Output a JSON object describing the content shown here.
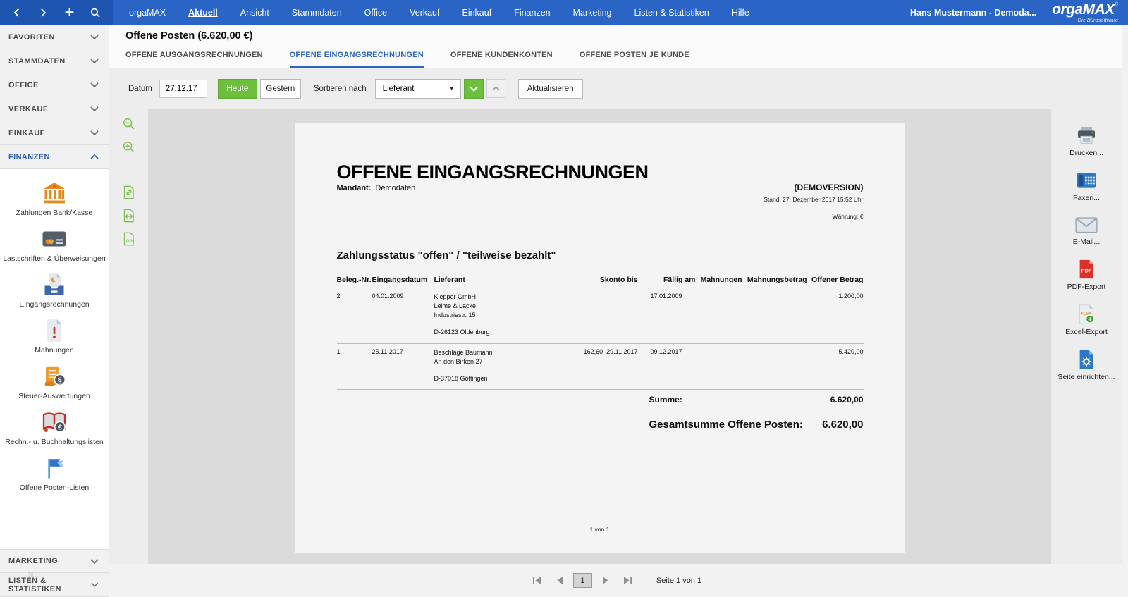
{
  "colors": {
    "topbar_blue": "#2a64c4",
    "topbar_dark_blue": "#1d55b0",
    "accent_green": "#6fbf3f",
    "accent_blue": "#2a65c0",
    "brand_orange": "#e8891c"
  },
  "topbar": {
    "menu": [
      "orgaMAX",
      "Aktuell",
      "Ansicht",
      "Stammdaten",
      "Office",
      "Verkauf",
      "Einkauf",
      "Finanzen",
      "Marketing",
      "Listen & Statistiken",
      "Hilfe"
    ],
    "active_menu": "Aktuell",
    "user": "Hans Mustermann - Demoda...",
    "logo": "orgaMAX",
    "logo_reg": "®",
    "logo_sub": "Die Bürosoftware"
  },
  "sidebar": {
    "sections_top": [
      "FAVORITEN",
      "STAMMDATEN",
      "OFFICE",
      "VERKAUF",
      "EINKAUF"
    ],
    "finanzen_label": "FINANZEN",
    "finance_items": [
      {
        "label": "Zahlungen Bank/Kasse",
        "icon": "bank-icon"
      },
      {
        "label": "Lastschriften & Überweisungen",
        "icon": "bank-card-icon"
      },
      {
        "label": "Eingangsrechnungen",
        "icon": "invoice-inbox-icon"
      },
      {
        "label": "Mahnungen",
        "icon": "warning-document-icon"
      },
      {
        "label": "Steuer-Auswertungen",
        "icon": "tax-scroll-icon"
      },
      {
        "label": "Rechn.- u. Buchhaltungslisten",
        "icon": "accounting-book-icon"
      },
      {
        "label": "Offene Posten-Listen",
        "icon": "flag-icon"
      }
    ],
    "sections_bottom": [
      "MARKETING",
      "LISTEN & STATISTIKEN"
    ],
    "watermark": "http"
  },
  "page": {
    "title": "Offene Posten (6.620,00 €)",
    "tabs": [
      "OFFENE AUSGANGSRECHNUNGEN",
      "OFFENE EINGANGSRECHNUNGEN",
      "OFFENE KUNDENKONTEN",
      "OFFENE POSTEN JE KUNDE"
    ],
    "active_tab": "OFFENE EINGANGSRECHNUNGEN"
  },
  "toolbar": {
    "datum_label": "Datum",
    "datum_value": "27.12.17",
    "heute_label": "Heute",
    "gestern_label": "Gestern",
    "sort_label": "Sortieren nach",
    "sort_value": "Lieferant",
    "aktualisieren_label": "Aktualisieren"
  },
  "preview_tools": {
    "items": [
      "zoom-out-icon",
      "zoom-in-icon",
      "fit-page-icon",
      "fit-width-icon",
      "zoom-100-icon"
    ],
    "hundred_label": "100%"
  },
  "report": {
    "title": "OFFENE EINGANGSRECHNUNGEN",
    "mandant_label": "Mandant:",
    "mandant_value": "Demodaten",
    "demoversion": "(DEMOVERSION)",
    "stand": "Stand:  27. Dezember 2017 15:52 Uhr",
    "waehrung": "Währung: €",
    "section_heading": "Zahlungsstatus \"offen\" / \"teilweise bezahlt\"",
    "columns": [
      "Beleg.-Nr.",
      "Eingangsdatum",
      "Lieferant",
      "Skonto bis",
      "Fällig am",
      "Mahnungen",
      "Mahnungsbetrag",
      "Offener Betrag"
    ],
    "rows": [
      {
        "beleg": "2",
        "eingangsdatum": "04.01.2009",
        "lieferant_lines": [
          "Klepper GmbH",
          "Leime & Lacke",
          "Industriestr. 15"
        ],
        "lieferant_city": "D-26123 Oldenburg",
        "skonto_bis": "",
        "faellig_am": "17.01.2009",
        "mahnungen": "",
        "mahnungsbetrag": "",
        "offener_betrag": "1.200,00"
      },
      {
        "beleg": "1",
        "eingangsdatum": "25.11.2017",
        "lieferant_lines": [
          "Beschläge Baumann",
          "An den Birken 27",
          ""
        ],
        "lieferant_city": "D-37018 Göttingen",
        "skonto_bis": "162,60  29.11.2017",
        "faellig_am": "09.12.2017",
        "mahnungen": "",
        "mahnungsbetrag": "",
        "offener_betrag": "5.420,00"
      }
    ],
    "summe_label": "Summe:",
    "summe_value": "6.620,00",
    "gesamt_label": "Gesamtsumme Offene Posten:",
    "gesamt_value": "6.620,00",
    "page_footer": "1 von 1"
  },
  "export_panel": {
    "items": [
      {
        "label": "Drucken...",
        "icon": "printer-icon"
      },
      {
        "label": "Faxen...",
        "icon": "fax-icon"
      },
      {
        "label": "E-Mail...",
        "icon": "email-icon"
      },
      {
        "label": "PDF-Export",
        "icon": "pdf-export-icon"
      },
      {
        "label": "Excel-Export",
        "icon": "excel-export-icon"
      },
      {
        "label": "Seite einrichten...",
        "icon": "page-setup-icon"
      }
    ]
  },
  "pagination": {
    "current_page": "1",
    "label": "Seite 1 von 1"
  }
}
